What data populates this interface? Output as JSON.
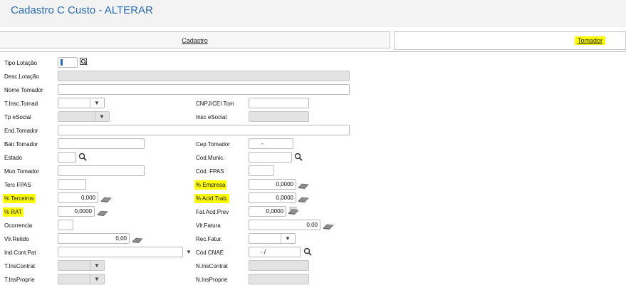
{
  "window": {
    "title": "Cadastro C Custo - ALTERAR"
  },
  "tabs": {
    "cadastro": "Cadastro",
    "tomador": "Tomador"
  },
  "form": {
    "tipo_lotacao": "Tipo Lotação",
    "desc_lotacao": "Desc.Lotação",
    "nome_tomador": "Nome Tomador",
    "t_insc_tomad": "T.Insc.Tomad",
    "cnpj_cei_tom": "CNPJ/CEI Tom",
    "tp_esocial": "Tp eSocial",
    "insc_esocial": "Insc eSocial",
    "end_tomador": "End.Tomador",
    "bair_tomador": "Bair.Tomador",
    "cep_tomador": "Cep Tomador",
    "cep_value": "-",
    "estado": "Estado",
    "cod_munic": "Cod.Munic.",
    "mun_tomador": "Mun.Tomador",
    "cod_fpas": "Cód. FPAS",
    "terc_fpas": "Terc FPAS",
    "pct_empresa": "% Empresa",
    "pct_empresa_value": "0,0000",
    "pct_terceiros": "% Terceiros",
    "pct_terceiros_value": "0,000",
    "pct_acid_trab": "% Acid.Trab.",
    "pct_acid_trab_value": "0,0000",
    "pct_rat": "% RAT",
    "pct_rat_value": "0,0000",
    "fat_acd_prev": "Fat.Acd.Prev",
    "fat_acd_prev_value": "0,0000",
    "ocorrencia": "Ocorrencia",
    "vlr_fatura": "Vlr.Fatura",
    "vlr_fatura_value": "0,00",
    "vlr_retido": "Vlr.Retido",
    "vlr_retido_value": "0,00",
    "rec_fatur": "Rec.Fatur.",
    "ind_cont_pat": "Ind.Cont.Pat",
    "cod_cnae": "Cód CNAE",
    "cod_cnae_value": "- /",
    "t_inscontrat": "T.InsContrat",
    "n_inscontrat": "N.InsContrat",
    "t_insproprie": "T.InsProprie",
    "n_insproprie": "N.InsProprie"
  },
  "icons": {
    "lookup": "magnifier-icon",
    "calc": "calculator-icon",
    "dropdown": "chevron-down-icon"
  },
  "colors": {
    "title": "#2a6bb8",
    "highlight": "#ffff00",
    "disabled": "#e3e3e3"
  }
}
